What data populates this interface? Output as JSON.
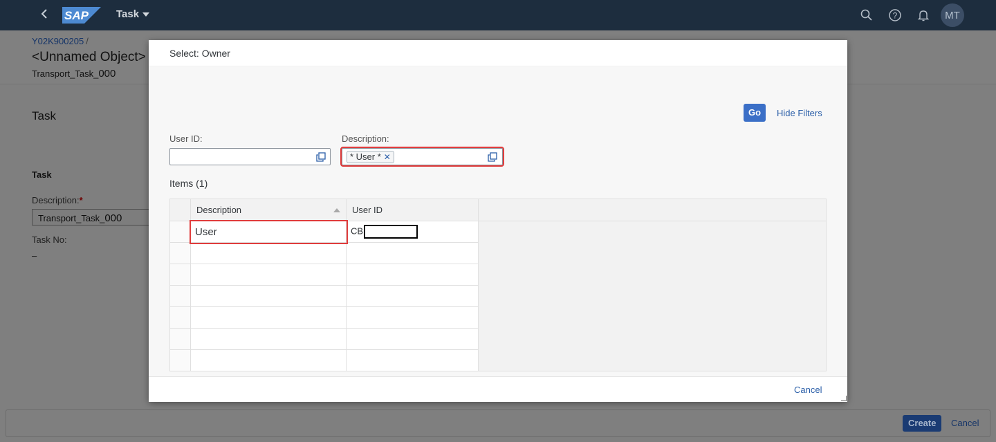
{
  "shell": {
    "back_icon": "chevron-left-icon",
    "logo": "SAP",
    "app_title": "Task",
    "icons": [
      "search-icon",
      "help-icon",
      "bell-icon"
    ],
    "avatar_initials": "MT"
  },
  "object_header": {
    "breadcrumb": "Y02K900205",
    "breadcrumb_sep": "/",
    "title": "<Unnamed Object>",
    "subtitle_prefix": "Transport_Task_",
    "subtitle_num": "000"
  },
  "form": {
    "section_title": "Task",
    "group_title": "Task",
    "description_label": "Description:",
    "required_mark": "*",
    "description_prefix": "Transport_Task_",
    "description_num": "000",
    "task_no_label": "Task No:",
    "task_no_value": "–"
  },
  "footer": {
    "create_label": "Create",
    "cancel_label": "Cancel"
  },
  "dialog": {
    "title": "Select: Owner",
    "go_label": "Go",
    "hide_filters_label": "Hide Filters",
    "user_id_label": "User ID:",
    "user_id_value": "",
    "description_label": "Description:",
    "description_token": "* User *",
    "items_title": "Items (1)",
    "columns": [
      "Description",
      "User ID"
    ],
    "rows": [
      {
        "description": "User",
        "user_id": "CB"
      }
    ],
    "cancel_label": "Cancel",
    "highlight_color": "#e03c3c"
  }
}
